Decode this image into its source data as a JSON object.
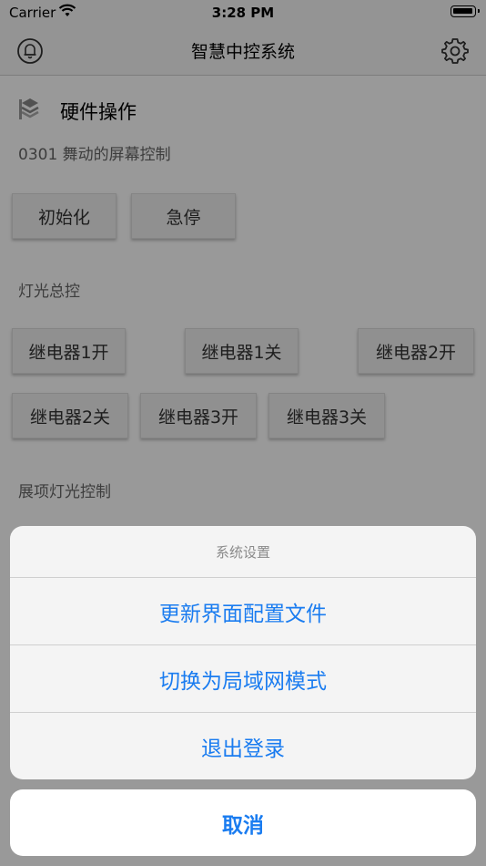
{
  "status_bar": {
    "carrier": "Carrier",
    "time": "3:28 PM"
  },
  "nav": {
    "title": "智慧中控系统",
    "left_icon": "bell-icon",
    "right_icon": "gear-icon"
  },
  "section": {
    "title": "硬件操作",
    "icon": "layers-icon",
    "subtitle": "0301 舞动的屏幕控制",
    "init_buttons": [
      "初始化",
      "急停"
    ],
    "lighting_label": "灯光总控",
    "relay_buttons": [
      "继电器1开",
      "继电器1关",
      "继电器2开",
      "继电器2关",
      "继电器3开",
      "继电器3关"
    ],
    "exhibit_label": "展项灯光控制"
  },
  "action_sheet": {
    "title": "系统设置",
    "items": [
      "更新界面配置文件",
      "切换为局域网模式",
      "退出登录"
    ],
    "cancel": "取消"
  },
  "colors": {
    "accent": "#1a7cf0",
    "overlay": "rgba(0,0,0,0.40)"
  }
}
